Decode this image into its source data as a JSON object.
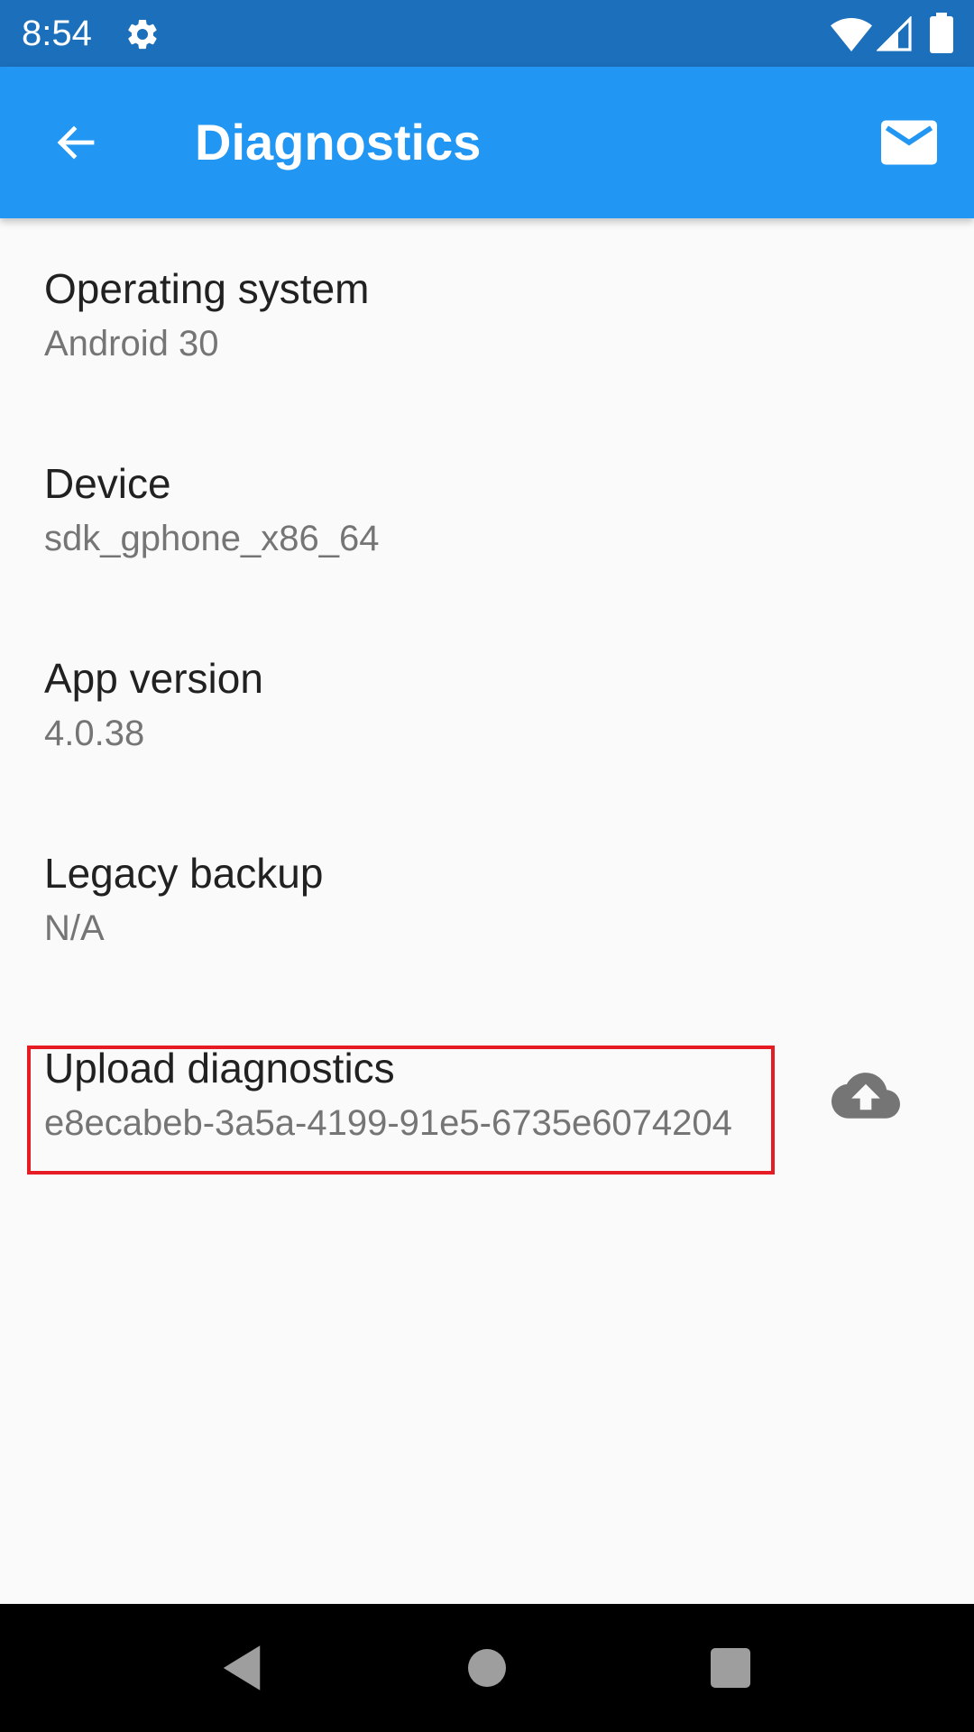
{
  "status_bar": {
    "time": "8:54",
    "icons": [
      "gear-icon",
      "wifi-icon",
      "cell-signal-icon",
      "battery-icon"
    ]
  },
  "app_bar": {
    "title": "Diagnostics",
    "back_icon": "arrow-back-icon",
    "action_icon": "email-icon"
  },
  "items": [
    {
      "title": "Operating system",
      "value": "Android 30"
    },
    {
      "title": "Device",
      "value": "sdk_gphone_x86_64"
    },
    {
      "title": "App version",
      "value": "4.0.38"
    },
    {
      "title": "Legacy backup",
      "value": "N/A"
    },
    {
      "title": "Upload diagnostics",
      "value": "e8ecabeb-3a5a-4199-91e5-6735e6074204",
      "action_icon": "cloud-upload-icon"
    }
  ],
  "nav_bar": {
    "icons": [
      "nav-back-icon",
      "nav-home-icon",
      "nav-recents-icon"
    ]
  },
  "colors": {
    "status_bar": "#1c6fbb",
    "app_bar": "#2196f3",
    "background": "#fafafa",
    "highlight": "#e51c23",
    "title_text": "#212121",
    "subtitle_text": "#757575"
  }
}
